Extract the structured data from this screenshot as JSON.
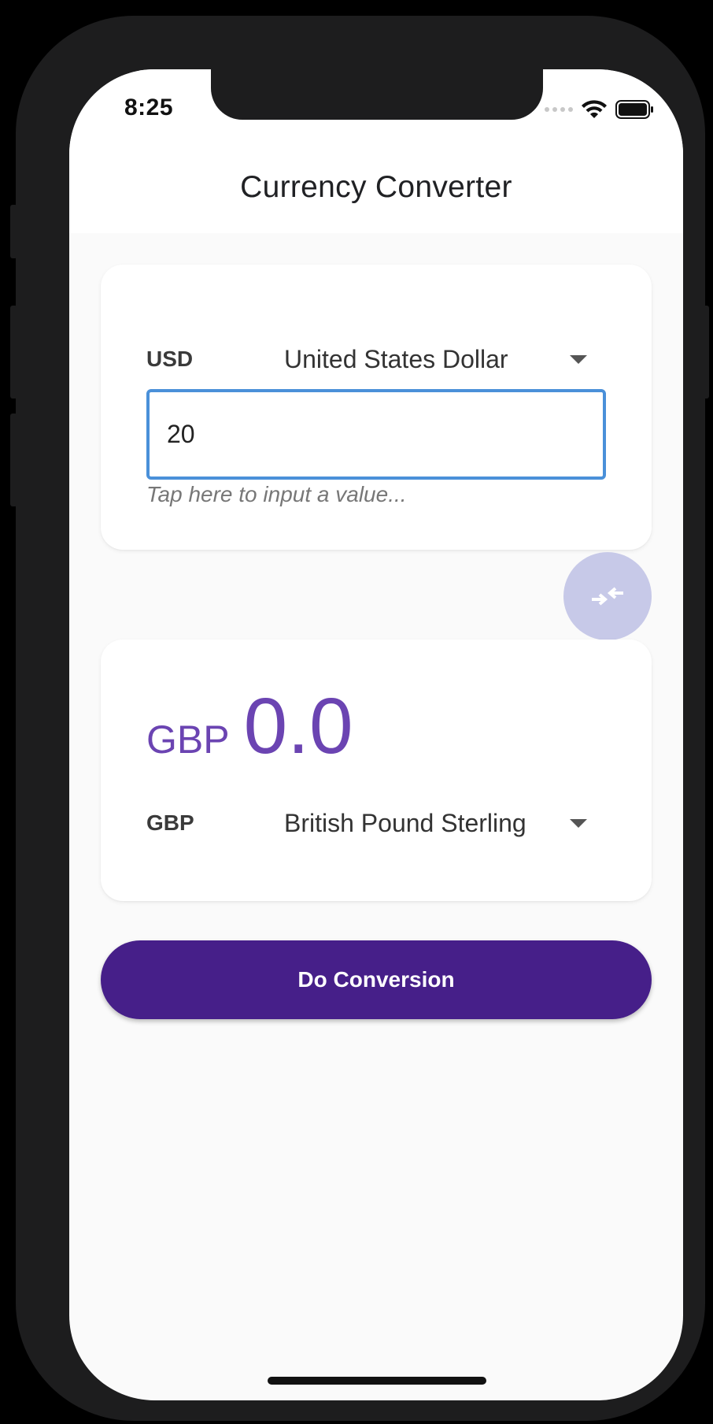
{
  "status_bar": {
    "time": "8:25"
  },
  "header": {
    "title": "Currency Converter"
  },
  "from": {
    "code": "USD",
    "name": "United States Dollar",
    "amount": "20",
    "hint": "Tap here to input a value..."
  },
  "to": {
    "result_code": "GBP",
    "result_value": "0.0",
    "code": "GBP",
    "name": "British Pound Sterling"
  },
  "actions": {
    "convert_label": "Do Conversion"
  },
  "colors": {
    "primary": "#461f89",
    "result_text": "#6b44b2",
    "input_border": "#4a90d9",
    "swap_button": "#c7c9e8"
  },
  "icons": {
    "swap": "swap-arrows-icon",
    "dropdown": "chevron-down-icon",
    "wifi": "wifi-icon",
    "battery": "battery-icon",
    "signal": "signal-icon"
  }
}
